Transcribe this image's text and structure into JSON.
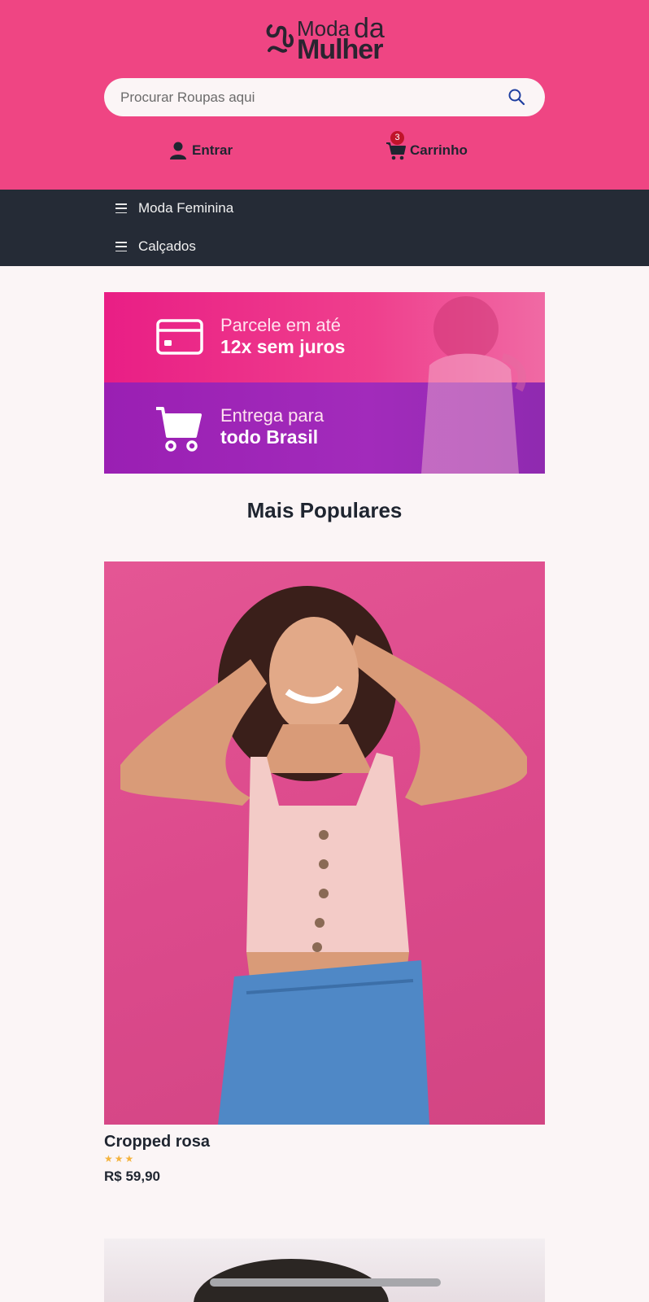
{
  "header": {
    "brand": {
      "line1": "Moda",
      "line2": "da",
      "line3": "Mulher"
    },
    "search": {
      "placeholder": "Procurar Roupas aqui",
      "value": ""
    },
    "login_label": "Entrar",
    "cart_label": "Carrinho",
    "cart_count": "3",
    "bg_color": "#ef4583"
  },
  "nav": {
    "items": [
      {
        "label": "Moda Feminina",
        "icon": "menu-icon"
      },
      {
        "label": "Calçados",
        "icon": "menu-icon"
      }
    ]
  },
  "banner": {
    "installments": {
      "line1": "Parcele em até",
      "line2": "12x sem juros",
      "icon": "credit-card-icon"
    },
    "delivery": {
      "line1": "Entrega para",
      "line2": "todo Brasil",
      "icon": "shopping-cart-icon"
    }
  },
  "main": {
    "section_title": "Mais Populares",
    "products": [
      {
        "name": "Cropped rosa",
        "rating": 3,
        "price": "R$ 59,90"
      }
    ]
  },
  "colors": {
    "accent": "#ef4583",
    "nav": "#252b36",
    "star": "#f4b33e",
    "badge": "#c0142a"
  }
}
